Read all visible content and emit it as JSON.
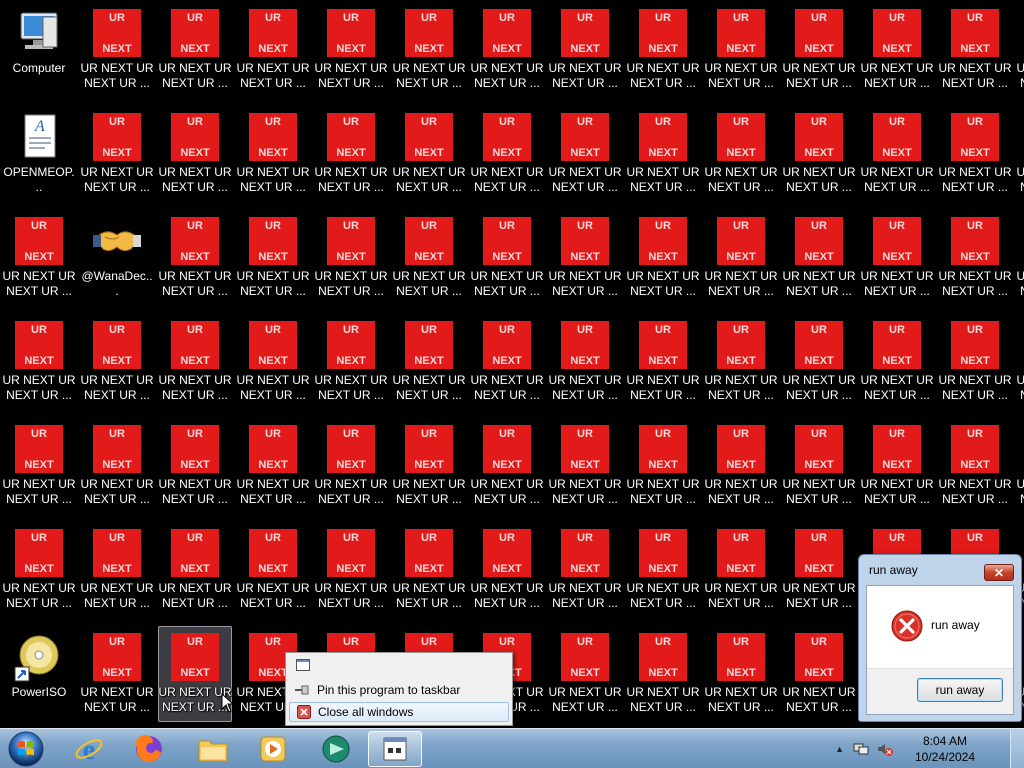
{
  "desktop": {
    "special_icons": {
      "computer": "Computer",
      "document": "OPENMEOP...",
      "wanadec": "@WanaDec...",
      "poweriso": "PowerISO"
    },
    "ur_icon": {
      "top_text": "UR",
      "bottom_text": "NEXT",
      "label": "UR NEXT UR NEXT UR ..."
    },
    "selected_icon_label": "UR NEXT UR NEXT UR ..."
  },
  "jumplist": {
    "items": [
      {
        "label": "Pin this program to taskbar",
        "icon": "pin-icon"
      },
      {
        "label": "Close all windows",
        "icon": "close-icon"
      }
    ]
  },
  "dialog": {
    "title": "run away",
    "message": "run away",
    "button_label": "run away",
    "close_glyph": "✕"
  },
  "taskbar": {
    "pinned": [
      "internet-explorer-icon",
      "firefox-icon",
      "file-explorer-icon",
      "media-player-icon",
      "app-icon"
    ],
    "time": "8:04 AM",
    "date": "10/24/2024"
  },
  "colors": {
    "ur_red": "#e21a1a",
    "taskbar": "#7ea4c8"
  }
}
